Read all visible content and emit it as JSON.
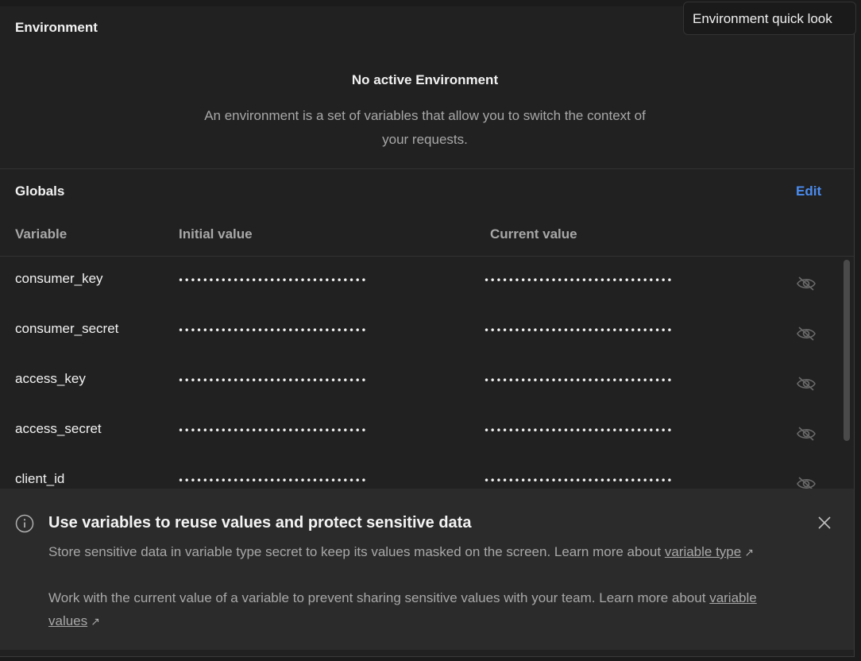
{
  "environment": {
    "section_title": "Environment",
    "empty_title": "No active Environment",
    "empty_description": "An environment is a set of variables that allow you to switch the context of your requests."
  },
  "globals": {
    "section_title": "Globals",
    "edit_label": "Edit",
    "columns": {
      "variable": "Variable",
      "initial_value": "Initial value",
      "current_value": "Current value"
    },
    "rows": [
      {
        "name": "consumer_key",
        "initial_value": "•••••••••••••••••••••••••••••••",
        "current_value": "•••••••••••••••••••••••••••••••",
        "icon": "eye-off-icon"
      },
      {
        "name": "consumer_secret",
        "initial_value": "•••••••••••••••••••••••••••••••",
        "current_value": "•••••••••••••••••••••••••••••••",
        "icon": "eye-off-icon"
      },
      {
        "name": "access_key",
        "initial_value": "•••••••••••••••••••••••••••••••",
        "current_value": "•••••••••••••••••••••••••••••••",
        "icon": "eye-off-icon"
      },
      {
        "name": "access_secret",
        "initial_value": "•••••••••••••••••••••••••••••••",
        "current_value": "•••••••••••••••••••••••••••••••",
        "icon": "eye-off-icon"
      },
      {
        "name": "client_id",
        "initial_value": "•••••••••••••••••••••••••••••••",
        "current_value": "•••••••••••••••••••••••••••••••",
        "icon": "eye-off-icon"
      }
    ]
  },
  "banner": {
    "title": "Use variables to reuse values and protect sensitive data",
    "line1_text": "Store sensitive data in variable type secret to keep its values masked on the screen. Learn more about",
    "line1_link": "variable type",
    "line2_text": "Work with the current value of a variable to prevent sharing sensitive values with your team. Learn more about",
    "line2_link": "variable values",
    "external_glyph": "↗"
  },
  "tooltip": {
    "text": "Environment quick look"
  },
  "colors": {
    "accent": "#4a8cf0",
    "panel_bg": "#212121",
    "banner_bg": "#2b2b2b"
  }
}
